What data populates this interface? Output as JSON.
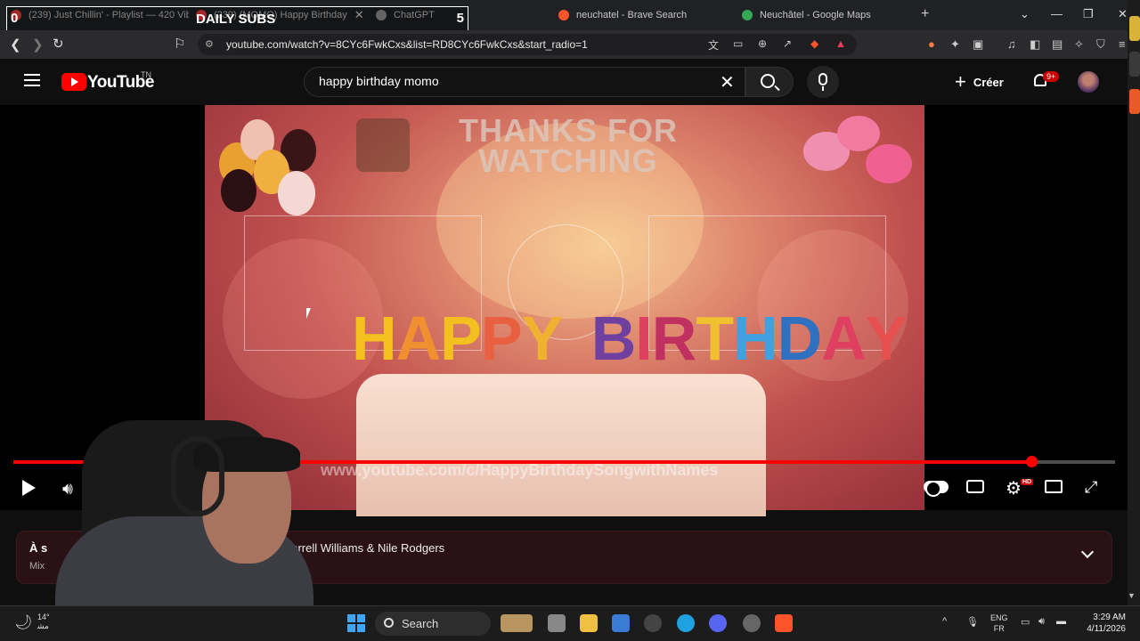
{
  "browser": {
    "tabs": [
      {
        "title": "(239) Just Chillin' - Playlist — 420 Vib",
        "favicon_color": "#ff3d3d"
      },
      {
        "title": "(239) (MOMO) Happy Birthday",
        "favicon_color": "#ff3d3d"
      },
      {
        "title": "ChatGPT",
        "favicon_color": "#9a9a9a"
      },
      {
        "title": "neuchatel - Brave Search",
        "favicon_color": "#fb542b"
      },
      {
        "title": "Neuchâtel - Google Maps",
        "favicon_color": "#34a853"
      }
    ],
    "url": "youtube.com/watch?v=8CYc6FwkCxs&list=RD8CYc6FwkCxs&start_radio=1"
  },
  "overlay": {
    "left_count": "0",
    "label": "DAILY SUBS",
    "right_count": "5"
  },
  "youtube": {
    "logo_text": "YouTube",
    "country_code": "TN",
    "search_query": "happy birthday momo",
    "create_label": "Créer",
    "notification_badge": "9+"
  },
  "video": {
    "endcard_title": "THANKS FOR WATCHING",
    "banner": "HAPPY BIRTHDAY",
    "watermark": "www.youtube.com/c/HappyBirthdaySongwithNames",
    "progress_fraction": 0.924,
    "hd_label": "HD"
  },
  "mix": {
    "title": "À s",
    "subtitle": "Mix",
    "artists": "harrell Williams & Nile Rodgers"
  },
  "taskbar": {
    "weather_temp": "14°",
    "weather_sub": "ﻣﺸ",
    "search_label": "Search",
    "lang_top": "ENG",
    "lang_bottom": "FR",
    "time": "3:29 AM",
    "date": "4/11/2026"
  },
  "colors": {
    "accent": "#ff0000",
    "background": "#0f0f0f"
  }
}
